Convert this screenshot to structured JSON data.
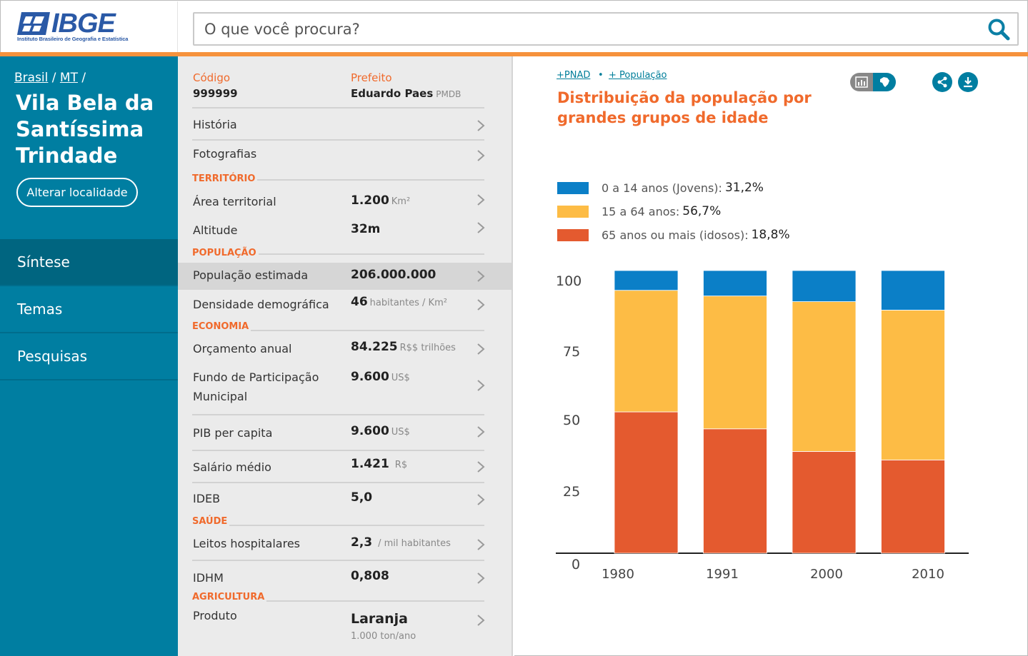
{
  "brand": {
    "logo_text": "IBGE",
    "logo_subtitle": "Instituto Brasileiro de Geografia e Estatística",
    "accent": "#f6923c",
    "blue": "#007ea1"
  },
  "search": {
    "placeholder": "O que você procura?"
  },
  "sidebar": {
    "breadcrumb": {
      "brasil": "Brasil",
      "sep1": " / ",
      "state": "MT",
      "sep2": " /"
    },
    "city": "Vila Bela da Santíssima Trindade",
    "change_button": "Alterar localidade",
    "nav": [
      {
        "label": "Síntese",
        "active": true
      },
      {
        "label": "Temas",
        "active": false
      },
      {
        "label": "Pesquisas",
        "active": false
      }
    ]
  },
  "info": {
    "codigo_label": "Código",
    "codigo_value": "999999",
    "prefeito_label": "Prefeito",
    "prefeito_name": "Eduardo Paes",
    "prefeito_party": "PMDB",
    "rows": {
      "historia": {
        "label": "História"
      },
      "fotografias": {
        "label": "Fotografias"
      },
      "area": {
        "label": "Área territorial",
        "value": "1.200",
        "unit": "Km²"
      },
      "altitude": {
        "label": "Altitude",
        "value": "32m"
      },
      "populacao": {
        "label": "População estimada",
        "value": "206.000.000"
      },
      "densidade": {
        "label": "Densidade demográfica",
        "value": "46",
        "unit": "habitantes / Km²"
      },
      "orcamento": {
        "label": "Orçamento anual",
        "value": "84.225",
        "unit": "R$$ trilhões"
      },
      "fundo": {
        "label_l1": "Fundo de Participação",
        "label_l2": "Municipal",
        "value": "9.600",
        "unit": "US$"
      },
      "pib": {
        "label": "PIB per capita",
        "value": "9.600",
        "unit": "US$"
      },
      "salario": {
        "label": "Salário médio",
        "value": "1.421",
        "unit": "R$"
      },
      "ideb": {
        "label": "IDEB",
        "value": "5,0"
      },
      "leitos": {
        "label": "Leitos hospitalares",
        "value": "2,3",
        "unit": "/ mil habitantes"
      },
      "idhm": {
        "label": "IDHM",
        "value": "0,808"
      },
      "produto": {
        "label": "Produto",
        "value": "Laranja",
        "sub": "1.000 ton/ano"
      }
    },
    "sections": {
      "territorio": "TERRITÓRIO",
      "populacao": "POPULAÇÃO",
      "economia": "ECONOMIA",
      "saude": "SAÚDE",
      "agricultura": "AGRICULTURA"
    }
  },
  "panel": {
    "link_pnad": "+PNAD",
    "link_dot": "•",
    "link_pop": "+ População",
    "title": "Distribuição da população por grandes grupos de idade",
    "icons": [
      "bar-chart-icon",
      "brazil-map-icon",
      "share-icon",
      "download-icon"
    ]
  },
  "chart_data": {
    "type": "bar",
    "stacked": true,
    "categories": [
      "1980",
      "1991",
      "2000",
      "2010"
    ],
    "series": [
      {
        "name": "65 anos ou mais (idosos)",
        "pct": "18,8%",
        "color": "#e45a2f",
        "values": [
          50,
          44,
          36,
          33
        ]
      },
      {
        "name": "15 a 64 anos",
        "pct": "56,7%",
        "color": "#fdbc45",
        "values": [
          43,
          47,
          53,
          53
        ]
      },
      {
        "name": "0 a 14 anos (Jovens)",
        "pct": "31,2%",
        "color": "#0b7fc7",
        "values": [
          7,
          9,
          11,
          14
        ]
      }
    ],
    "legend_order": [
      2,
      1,
      0
    ],
    "ylim": [
      0,
      100
    ],
    "yticks": [
      0,
      25,
      50,
      75,
      100
    ],
    "grid": false,
    "legend_position": "top-left"
  }
}
